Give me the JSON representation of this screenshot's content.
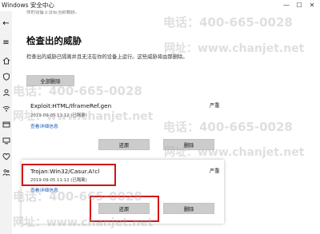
{
  "window": {
    "title": "Windows 安全中心",
    "controls": {
      "minimize": "—",
      "maximize": "☐",
      "close": "✕"
    }
  },
  "nav": {
    "items": [
      {
        "name": "back-icon",
        "glyph": "←"
      },
      {
        "name": "menu-icon",
        "glyph": "≡"
      },
      {
        "name": "home-icon"
      },
      {
        "name": "shield-icon"
      },
      {
        "name": "account-icon"
      },
      {
        "name": "wifi-icon"
      },
      {
        "name": "app-browser-icon"
      },
      {
        "name": "device-security-icon"
      },
      {
        "name": "health-icon"
      },
      {
        "name": "family-icon"
      }
    ]
  },
  "main": {
    "clipped_text": "你的设备上没有当前威胁。",
    "heading": "检查出的威胁",
    "description": "检查出的威胁已隔离并且无法在你的设备上运行。这些威胁将由那删除。",
    "remove_all_label": "全部删除",
    "threats": [
      {
        "name": "Exploit:HTML/IframeRef.gen",
        "date": "2019-09-05 11:12 (已隔离)",
        "level": "严重",
        "details_link": "查看详细信息",
        "restore_label": "还原",
        "remove_label": "删除"
      },
      {
        "name": "Trojan:Win32/Casur.A!cl",
        "date": "2019-09-05 11:12 (已隔离)",
        "level": "严重",
        "details_link": "查看详细信息",
        "restore_label": "还原",
        "remove_label": "删除"
      }
    ]
  },
  "watermarks": {
    "phone": "电话：400-665-0028",
    "site": "网址：www.chanjet.net"
  }
}
